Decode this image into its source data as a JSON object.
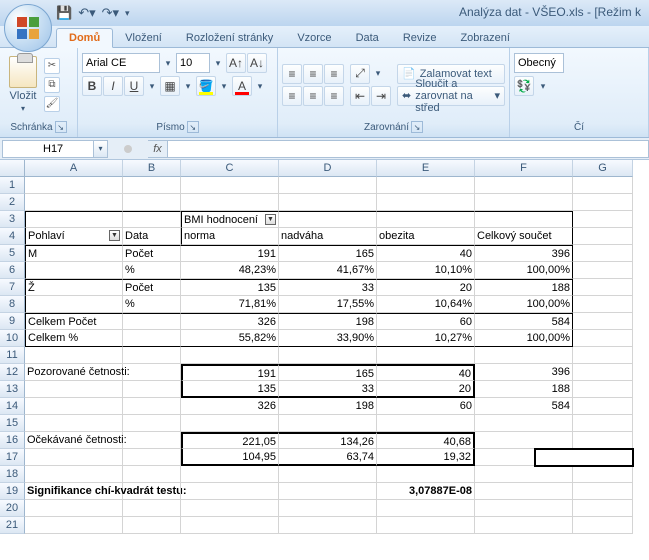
{
  "window_title": "Analýza dat - VŠEO.xls - [Režim k",
  "tabs": [
    "Domů",
    "Vložení",
    "Rozložení stránky",
    "Vzorce",
    "Data",
    "Revize",
    "Zobrazení"
  ],
  "active_tab": 0,
  "clipboard": {
    "paste": "Vložit",
    "label": "Schránka"
  },
  "font": {
    "name": "Arial CE",
    "size": "10",
    "label": "Písmo"
  },
  "alignment": {
    "wrap": "Zalamovat text",
    "merge": "Sloučit a zarovnat na střed",
    "label": "Zarovnání"
  },
  "number": {
    "general": "Obecný",
    "label": "Čí"
  },
  "namebox": "H17",
  "cols": [
    "A",
    "B",
    "C",
    "D",
    "E",
    "F",
    "G"
  ],
  "cells": {
    "r3c3": "BMI hodnocení",
    "r4": {
      "A": "Pohlaví",
      "B": "Data",
      "C": "norma",
      "D": "nadváha",
      "E": "obezita",
      "F": "Celkový součet"
    },
    "r5": {
      "A": "M",
      "B": "Počet",
      "C": "191",
      "D": "165",
      "E": "40",
      "F": "396"
    },
    "r6": {
      "B": "%",
      "C": "48,23%",
      "D": "41,67%",
      "E": "10,10%",
      "F": "100,00%"
    },
    "r7": {
      "A": "Ž",
      "B": "Počet",
      "C": "135",
      "D": "33",
      "E": "20",
      "F": "188"
    },
    "r8": {
      "B": "%",
      "C": "71,81%",
      "D": "17,55%",
      "E": "10,64%",
      "F": "100,00%"
    },
    "r9": {
      "A": "Celkem Počet",
      "C": "326",
      "D": "198",
      "E": "60",
      "F": "584"
    },
    "r10": {
      "A": "Celkem %",
      "C": "55,82%",
      "D": "33,90%",
      "E": "10,27%",
      "F": "100,00%"
    },
    "r12": {
      "A": "Pozorované četnosti:",
      "C": "191",
      "D": "165",
      "E": "40",
      "F": "396"
    },
    "r13": {
      "C": "135",
      "D": "33",
      "E": "20",
      "F": "188"
    },
    "r14": {
      "C": "326",
      "D": "198",
      "E": "60",
      "F": "584"
    },
    "r16": {
      "A": "Očekávané četnosti:",
      "C": "221,05",
      "D": "134,26",
      "E": "40,68"
    },
    "r17": {
      "C": "104,95",
      "D": "63,74",
      "E": "19,32"
    },
    "r19": {
      "A": "Signifikance chí-kvadrát testu:",
      "E": "3,07887E-08"
    }
  }
}
